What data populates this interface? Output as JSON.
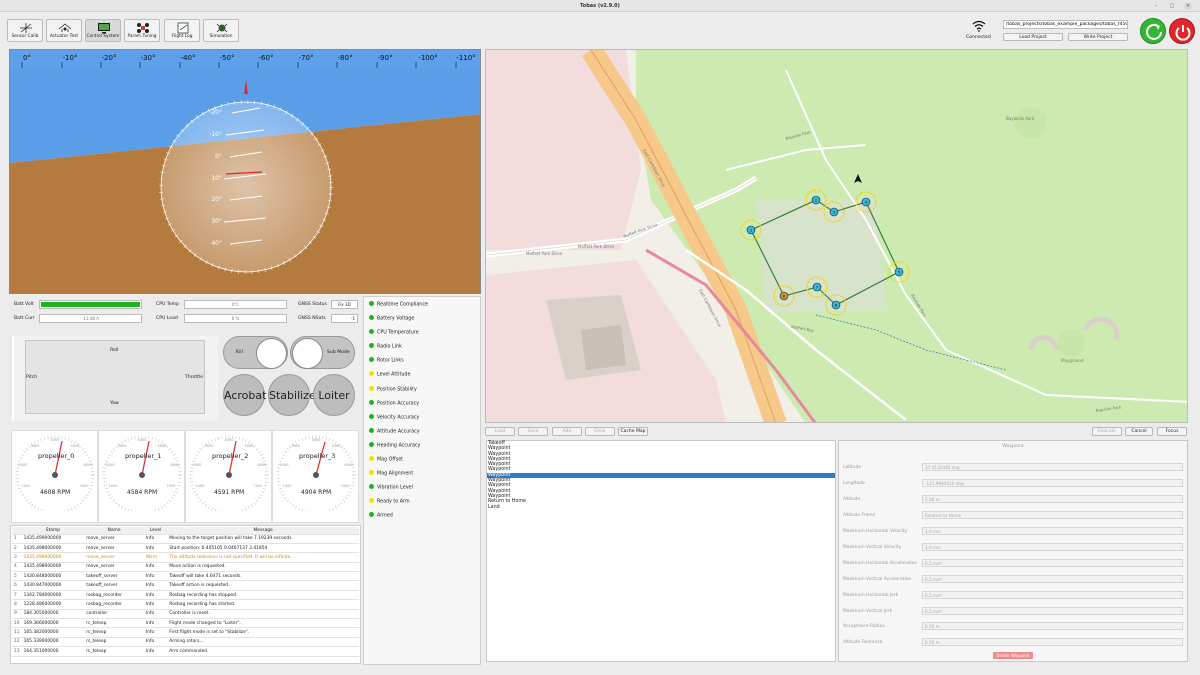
{
  "window": {
    "title": "Tobas (v2.9.0)",
    "minimize": "–",
    "maximize": "□",
    "close": "×"
  },
  "toolbar": [
    {
      "label": "Sensor Calib",
      "icon": "sensor-calib-icon"
    },
    {
      "label": "Actuator Test",
      "icon": "actuator-test-icon"
    },
    {
      "label": "Control System",
      "icon": "control-system-icon",
      "active": true
    },
    {
      "label": "Param Tuning",
      "icon": "param-tuning-icon"
    },
    {
      "label": "Flight Log",
      "icon": "flight-log-icon"
    },
    {
      "label": "Simulation",
      "icon": "simulation-icon"
    }
  ],
  "connection": {
    "status": "Connected",
    "project_path": "/tobas_projects/tobas_example_packages/tobas_f450.TBS",
    "load_label": "Load Project",
    "write_label": "Write Project"
  },
  "colors": {
    "accent": "#2f7cc5",
    "ok": "#1db31d",
    "warn": "#f2e200",
    "power": "#e0262b",
    "start": "#33b733",
    "sky": "#5a9ee8",
    "ground": "#b57a3e"
  },
  "attitude": {
    "heading_ticks": [
      "0°",
      "-10°",
      "-20°",
      "-30°",
      "-40°",
      "-50°",
      "-60°",
      "-70°",
      "-80°",
      "-90°",
      "-100°",
      "-110°"
    ],
    "pitch_labels": [
      "-20°",
      "-10°",
      "0°",
      "10°",
      "20°",
      "30°",
      "40°"
    ]
  },
  "status": {
    "batt_volt_label": "Batt Volt",
    "batt_volt_value": "",
    "batt_volt_level": 1.0,
    "batt_curr_label": "Batt Curr",
    "batt_curr_value": "-13.48 A",
    "cpu_temp_label": "CPU Temp",
    "cpu_temp_value": "0°C",
    "cpu_load_label": "CPU Load",
    "cpu_load_value": "0 %",
    "gnss_status_label": "GNSS Status",
    "gnss_status_value": "Fix 3D",
    "gnss_nsats_label": "GNSS NSats",
    "gnss_nsats_value": "-1"
  },
  "sticks": {
    "roll": "Roll",
    "pitch": "Pitch",
    "throttle": "Throttle",
    "yaw": "Yaw"
  },
  "toggles": {
    "kill": "Kill",
    "sub_mode": "Sub Mode"
  },
  "modes": [
    "Acrobat",
    "Stabilize",
    "Loiter"
  ],
  "propellers": [
    {
      "name": "propeller_0",
      "rpm": "4608 RPM"
    },
    {
      "name": "propeller_1",
      "rpm": "4584 RPM"
    },
    {
      "name": "propeller_2",
      "rpm": "4591 RPM"
    },
    {
      "name": "propeller_3",
      "rpm": "4904 RPM"
    }
  ],
  "gauge_scale": [
    "1000",
    "2000",
    "3000",
    "4000",
    "5000",
    "6000",
    "7000"
  ],
  "log": {
    "headers": [
      "Stamp",
      "Name",
      "Level",
      "Message"
    ],
    "rows": [
      {
        "n": "1",
        "stamp": "1435.499000000",
        "name": "move_server",
        "level": "Info",
        "msg": "Moving to the target position will take 7.19239 seconds."
      },
      {
        "n": "2",
        "stamp": "1435.498000000",
        "name": "move_server",
        "level": "Info",
        "msg": "Start position: 0.405105 0.0467137  3.41854"
      },
      {
        "n": "3",
        "stamp": "1435.498000000",
        "name": "move_server",
        "level": "Warn",
        "msg": "The altitude tolerance is not specified. It will be infinite."
      },
      {
        "n": "4",
        "stamp": "1435.498000000",
        "name": "move_server",
        "level": "Info",
        "msg": "Move action is requested."
      },
      {
        "n": "5",
        "stamp": "1430.848000000",
        "name": "takeoff_server",
        "level": "Info",
        "msg": "Takeoff will take 4.6471 seconds."
      },
      {
        "n": "6",
        "stamp": "1430.847000000",
        "name": "takeoff_server",
        "level": "Info",
        "msg": "Takeoff action is requested."
      },
      {
        "n": "7",
        "stamp": "1342.784000000",
        "name": "rosbag_recorder",
        "level": "Info",
        "msg": "Rosbag recording has stopped."
      },
      {
        "n": "8",
        "stamp": "1228.486000000",
        "name": "rosbag_recorder",
        "level": "Info",
        "msg": "Rosbag recording has started."
      },
      {
        "n": "9",
        "stamp": "184.305000000",
        "name": "controller",
        "level": "Info",
        "msg": "Controller is reset."
      },
      {
        "n": "10",
        "stamp": "169.366000000",
        "name": "rc_teleop",
        "level": "Info",
        "msg": "Flight mode changed to \"Loiter\"."
      },
      {
        "n": "11",
        "stamp": "165.382000000",
        "name": "rc_teleop",
        "level": "Info",
        "msg": "First flight mode is set to \"Stabilize\"."
      },
      {
        "n": "12",
        "stamp": "165.339000000",
        "name": "rc_teleop",
        "level": "Info",
        "msg": "Arming rotors..."
      },
      {
        "n": "13",
        "stamp": "164.351000000",
        "name": "rc_teleop",
        "level": "Info",
        "msg": "Arm commanded."
      }
    ]
  },
  "checks": [
    {
      "label": "Realtime Compliance",
      "state": "ok"
    },
    {
      "label": "Battery Voltage",
      "state": "ok"
    },
    {
      "label": "CPU Temperature",
      "state": "ok"
    },
    {
      "label": "Radio Link",
      "state": "ok"
    },
    {
      "label": "Rotor Links",
      "state": "ok"
    },
    {
      "label": "Level Attitude",
      "state": "warn"
    },
    {
      "label": "Position Stability",
      "state": "warn"
    },
    {
      "label": "Position Accuracy",
      "state": "ok"
    },
    {
      "label": "Velocity Accuracy",
      "state": "ok"
    },
    {
      "label": "Attitude Accuracy",
      "state": "ok"
    },
    {
      "label": "Heading Accuracy",
      "state": "ok"
    },
    {
      "label": "Mag Offset",
      "state": "warn"
    },
    {
      "label": "Mag Alignment",
      "state": "warn"
    },
    {
      "label": "Vibration Level",
      "state": "ok"
    },
    {
      "label": "Ready to Arm",
      "state": "warn"
    },
    {
      "label": "Armed",
      "state": "ok"
    }
  ],
  "map": {
    "roads": [
      "Moffett Park Drive",
      "Moffett Park Drive",
      "Moffett Park Drive",
      "East Caribbean Drive",
      "East Caribbean Drive",
      "Bayside Park",
      "Bayside Park",
      "Bayside Park",
      "Baylands Park",
      "Moffett Bay",
      "Playground"
    ],
    "waypoint_numbers": [
      "1",
      "2",
      "3",
      "4",
      "5",
      "6",
      "7",
      "8"
    ]
  },
  "mission_buttons": {
    "load": "Load",
    "save": "Save",
    "add": "Add",
    "clear": "Clear",
    "cache_map": "Cache Map",
    "execute": "Execute",
    "cancel": "Cancel",
    "focus": "Focus"
  },
  "waypoints": [
    "Takeoff",
    "Waypoint",
    "Waypoint",
    "Waypoint",
    "Waypoint",
    "Waypoint",
    "Waypoint",
    "Waypoint",
    "Waypoint",
    "Waypoint",
    "Waypoint",
    "Return to Home",
    "Land"
  ],
  "selected_waypoint": 6,
  "details": {
    "title": "Waypoint",
    "rows": [
      {
        "label": "Latitude",
        "value": "37.4132440 deg"
      },
      {
        "label": "Longitude",
        "value": "-121.9940010 deg"
      },
      {
        "label": "Altitude",
        "value": "5.00 m"
      },
      {
        "label": "Altitude Frame",
        "value": "Relative to Home"
      },
      {
        "label": "Maximum Horizontal Velocity",
        "value": "1.0 m/s"
      },
      {
        "label": "Maximum Vertical Velocity",
        "value": "1.0 m/s"
      },
      {
        "label": "Maximum Horizontal Acceleration",
        "value": "0.5 m/s²"
      },
      {
        "label": "Maximum Vertical Acceleration",
        "value": "0.5 m/s²"
      },
      {
        "label": "Maximum Horizontal Jerk",
        "value": "0.5 m/s³"
      },
      {
        "label": "Maximum Vertical Jerk",
        "value": "0.5 m/s³"
      },
      {
        "label": "Acceptance Radius",
        "value": "0.50 m"
      },
      {
        "label": "Altitude Tolerance",
        "value": "0.50 m"
      }
    ],
    "delete_label": "Delete Waypoint"
  }
}
